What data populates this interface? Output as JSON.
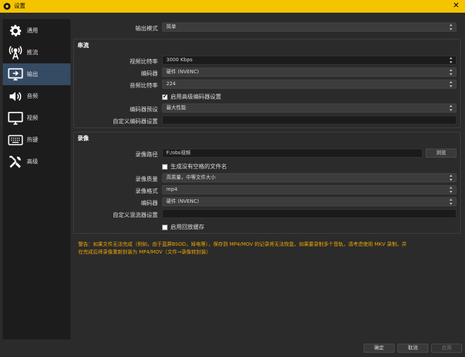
{
  "window": {
    "title": "设置",
    "close_symbol": "✕"
  },
  "sidebar": {
    "items": [
      {
        "label": "通用",
        "icon": "gear-icon",
        "active": false
      },
      {
        "label": "推流",
        "icon": "broadcast-icon",
        "active": false
      },
      {
        "label": "输出",
        "icon": "monitor-output-icon",
        "active": true
      },
      {
        "label": "音频",
        "icon": "speaker-icon",
        "active": false
      },
      {
        "label": "视频",
        "icon": "monitor-icon",
        "active": false
      },
      {
        "label": "热键",
        "icon": "keyboard-icon",
        "active": false
      },
      {
        "label": "高级",
        "icon": "tools-icon",
        "active": false
      }
    ]
  },
  "output_mode": {
    "label": "输出模式",
    "value": "简单"
  },
  "streaming": {
    "title": "串流",
    "video_bitrate": {
      "label": "视频比特率",
      "value": "3000 Kbps"
    },
    "encoder": {
      "label": "编码器",
      "value": "硬件 (NVENC)"
    },
    "audio_bitrate": {
      "label": "音频比特率",
      "value": "224"
    },
    "advanced_encoder": {
      "label": "启用高级编码器设置",
      "checked": true
    },
    "encoder_preset": {
      "label": "编码器预设",
      "value": "最大性能"
    },
    "custom_encoder": {
      "label": "自定义编码器设置",
      "value": ""
    }
  },
  "recording": {
    "title": "录像",
    "path": {
      "label": "录像路径",
      "value": "F:/obs视频",
      "browse": "浏览"
    },
    "no_space": {
      "label": "生成没有空格的文件名",
      "checked": false
    },
    "quality": {
      "label": "录像质量",
      "value": "高质量，中等文件大小"
    },
    "format": {
      "label": "录像格式",
      "value": "mp4"
    },
    "encoder": {
      "label": "编码器",
      "value": "硬件 (NVENC)"
    },
    "custom_muxer": {
      "label": "自定义混流器设置",
      "value": ""
    },
    "replay_buffer": {
      "label": "启用回放缓存",
      "checked": false
    }
  },
  "warning": {
    "line1": "警告：如果文件无法完成（例如，由于蓝屏BSOD，掉电等），保存到 MP4/MOV 的记录将无法恢复。如果要录制多个音轨，请考虑使用 MKV 录制，并",
    "line2": "在完成后将录像重新封装为 MP4/MOV（文件→录像转封装）"
  },
  "footer": {
    "ok": "确定",
    "cancel": "取消",
    "apply": "应用"
  }
}
